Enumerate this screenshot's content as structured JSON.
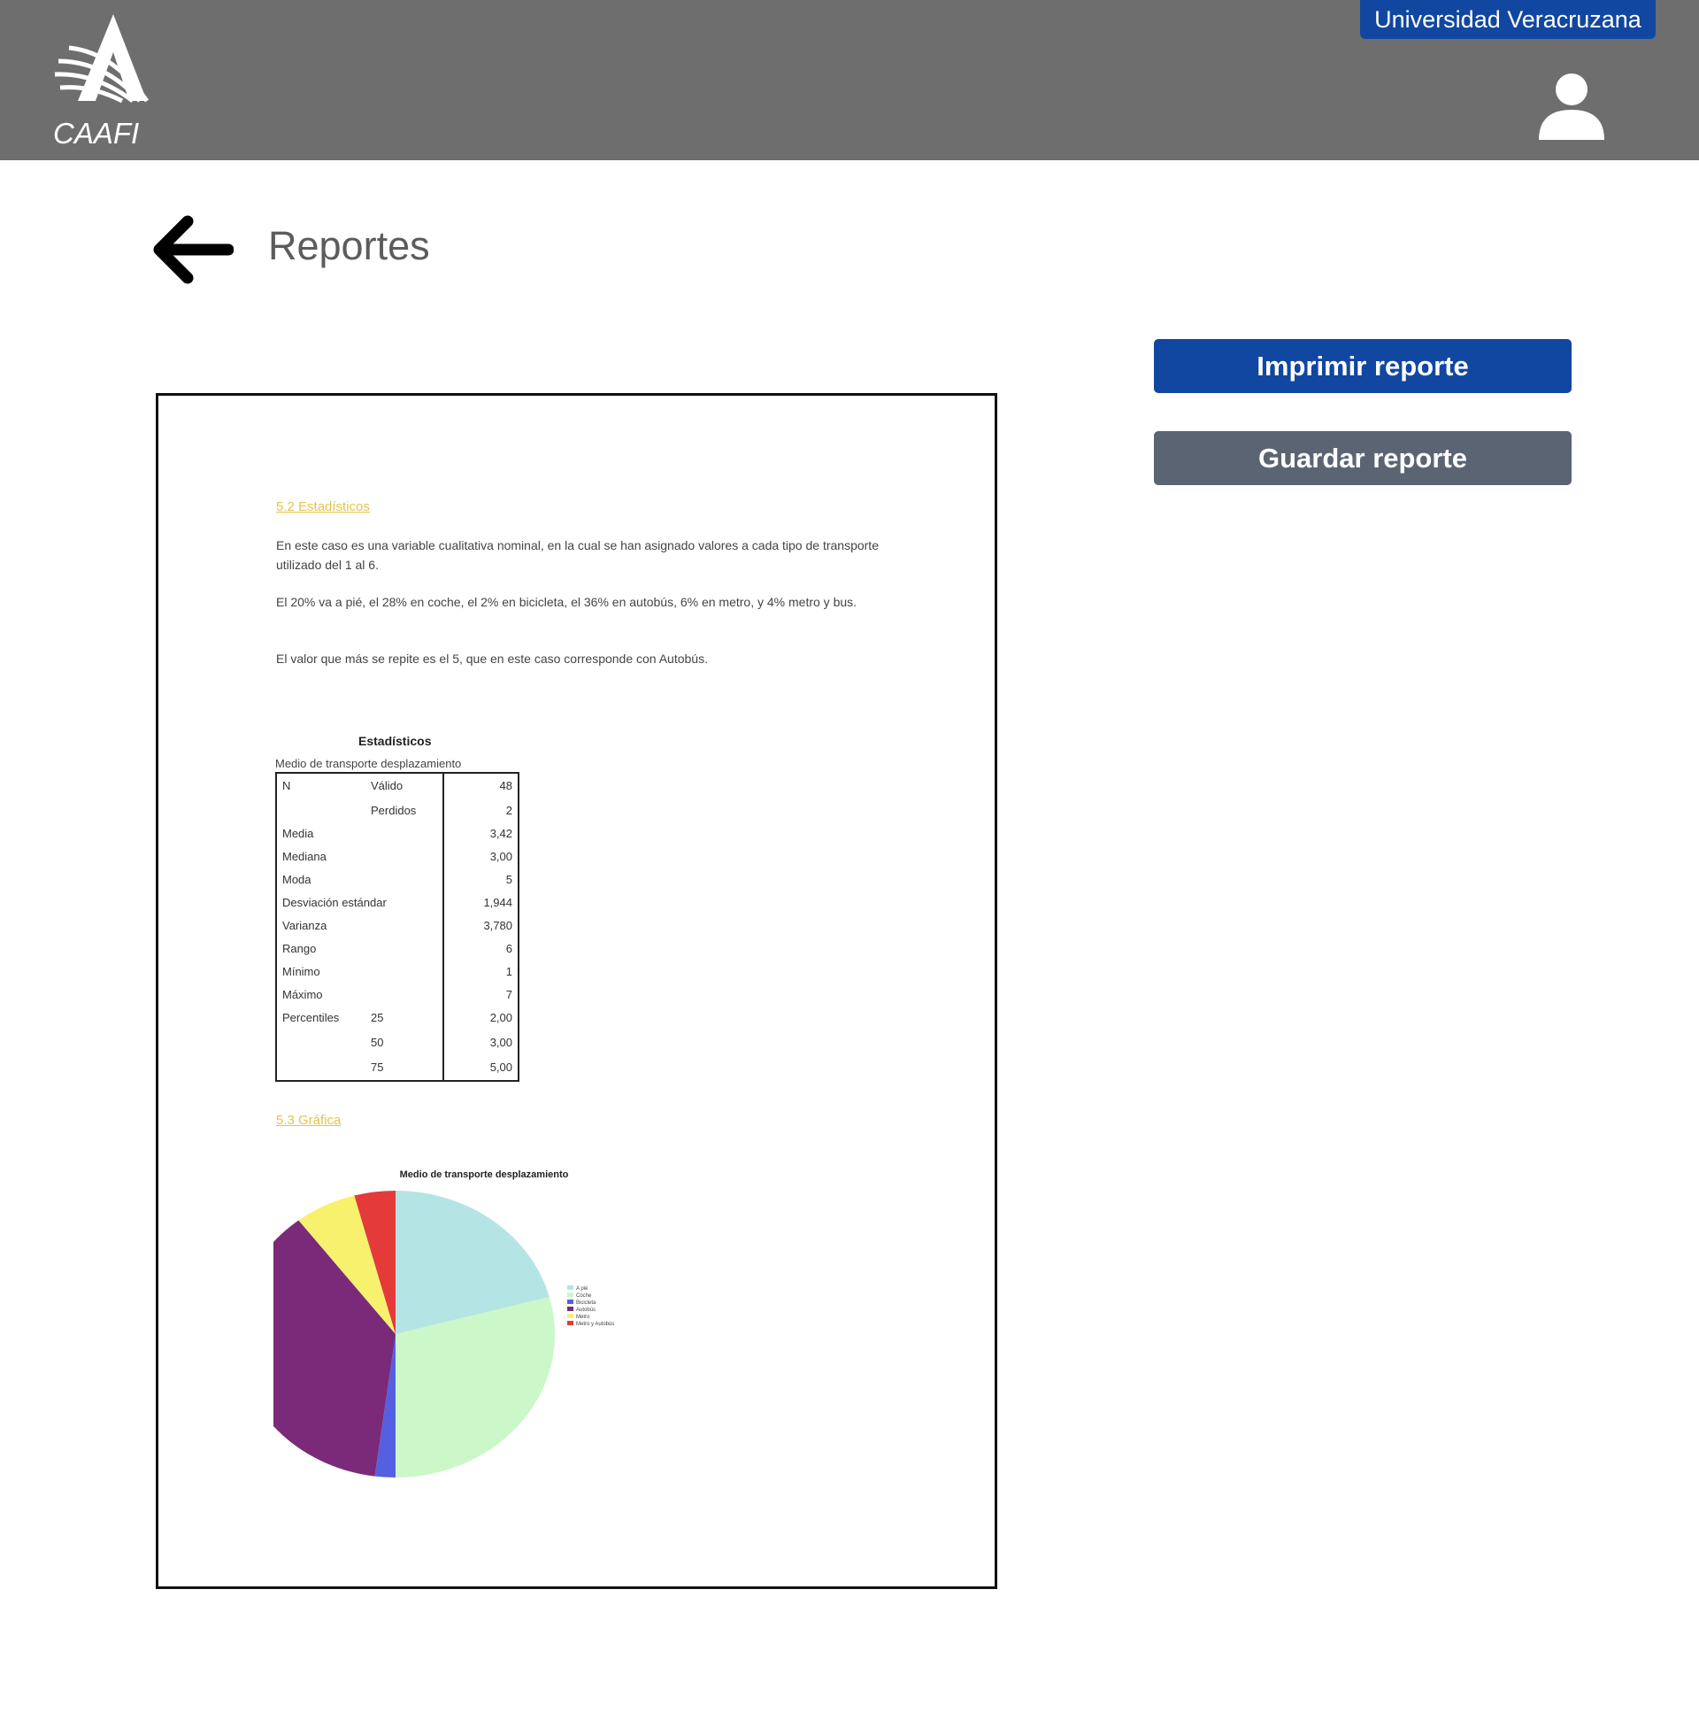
{
  "header": {
    "logo_text": "CAAFI",
    "university": "Universidad Veracruzana",
    "colors": {
      "bar": "#6e6e6e",
      "accent": "#1147a0"
    }
  },
  "page": {
    "title": "Reportes"
  },
  "actions": {
    "print_label": "Imprimir reporte",
    "save_label": "Guardar reporte"
  },
  "report": {
    "section1_heading": "5.2 Estadísticos",
    "paragraphs": [
      "En este caso es una variable cualitativa nominal, en la cual se han asignado valores a cada tipo de transporte utilizado del 1 al 6.",
      "El 20% va a pié, el 28% en coche, el 2% en bicicleta, el 36% en autobús, 6% en metro, y 4% metro y bus.",
      "El valor que más se repite es el 5, que en este caso corresponde con Autobús."
    ],
    "stats": {
      "title": "Estadísticos",
      "subtitle": "Medio de transporte desplazamiento",
      "rows": [
        {
          "label": "N",
          "sub": "Válido",
          "value": "48"
        },
        {
          "label": "",
          "sub": "Perdidos",
          "value": "2"
        },
        {
          "label": "Media",
          "sub": "",
          "value": "3,42"
        },
        {
          "label": "Mediana",
          "sub": "",
          "value": "3,00"
        },
        {
          "label": "Moda",
          "sub": "",
          "value": "5"
        },
        {
          "label": "Desviación estándar",
          "sub": "",
          "value": "1,944"
        },
        {
          "label": "Varianza",
          "sub": "",
          "value": "3,780"
        },
        {
          "label": "Rango",
          "sub": "",
          "value": "6"
        },
        {
          "label": "Mínimo",
          "sub": "",
          "value": "1"
        },
        {
          "label": "Máximo",
          "sub": "",
          "value": "7"
        },
        {
          "label": "Percentiles",
          "sub": "25",
          "value": "2,00"
        },
        {
          "label": "",
          "sub": "50",
          "value": "3,00"
        },
        {
          "label": "",
          "sub": "75",
          "value": "5,00"
        }
      ]
    },
    "section2_heading": "5.3 Gráfica",
    "chart_data": {
      "type": "pie",
      "title": "Medio de transporte desplazamiento",
      "legend_position": "right",
      "slices": [
        {
          "label": "A pié",
          "value": 20,
          "color": "#b5e4e4"
        },
        {
          "label": "Coche",
          "value": 28,
          "color": "#ccf7c9"
        },
        {
          "label": "Bicicleta",
          "value": 2,
          "color": "#5560e0"
        },
        {
          "label": "Autobús",
          "value": 36,
          "color": "#7a2a78"
        },
        {
          "label": "Metro",
          "value": 6,
          "color": "#f7f16e"
        },
        {
          "label": "Metro y Autobús",
          "value": 4,
          "color": "#e53a3a"
        }
      ]
    }
  }
}
